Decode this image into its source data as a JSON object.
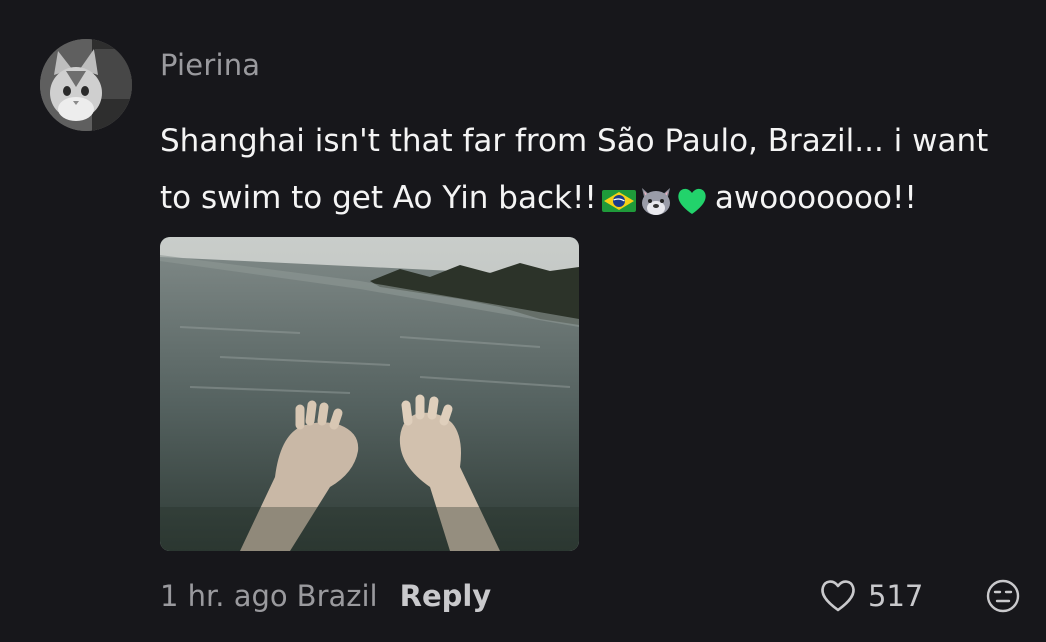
{
  "comment": {
    "author": "Pierina",
    "text_line1": "Shanghai isn't that far from São Paulo, Brazil... i want",
    "text_line2_before": "to swim to get Ao Yin back!!",
    "text_line2_after": "awooooooo!!",
    "emojis": [
      "brazil-flag",
      "wolf-face",
      "green-heart"
    ],
    "timestamp": "1 hr. ago",
    "location": "Brazil",
    "reply_label": "Reply",
    "like_count": "517"
  },
  "colors": {
    "background": "#17171b",
    "muted_text": "#9a9a9e",
    "primary_text": "#f4f4f4"
  }
}
